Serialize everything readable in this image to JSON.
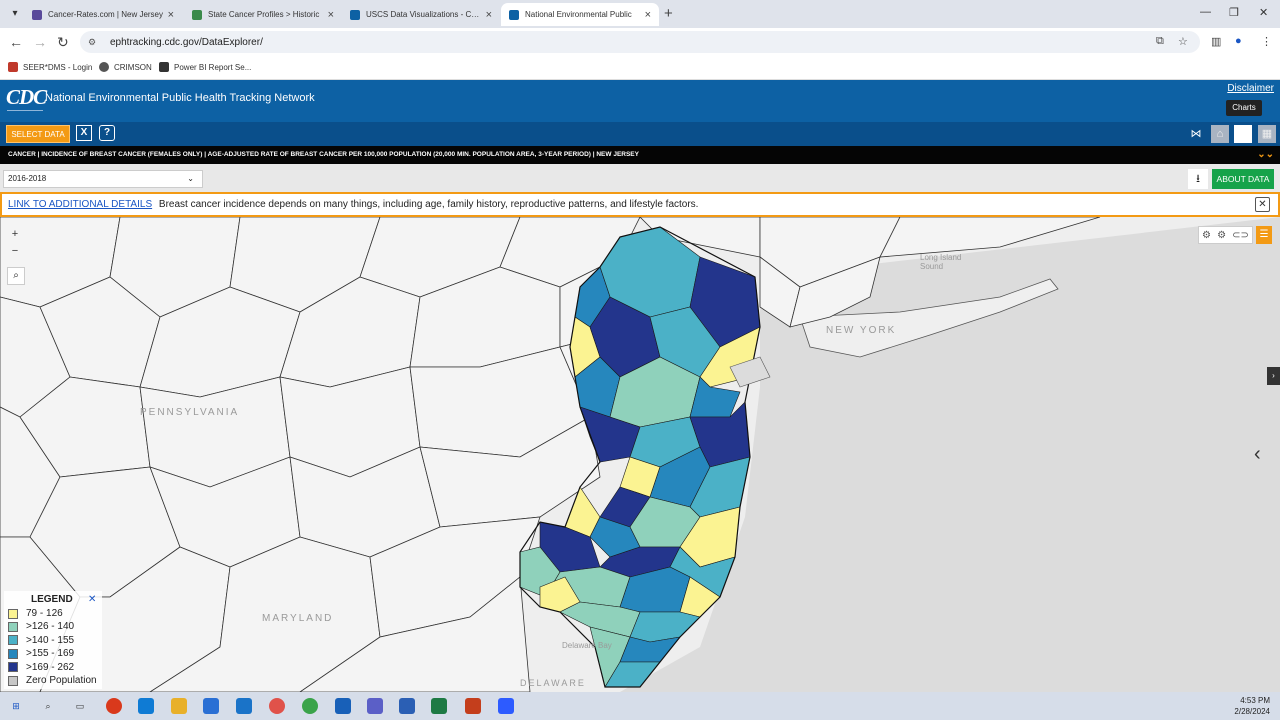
{
  "browser": {
    "tabs": [
      {
        "title": "Cancer-Rates.com | New Jersey",
        "active": false,
        "favicon_color": "#5a4a9a"
      },
      {
        "title": "State Cancer Profiles > Historic",
        "active": false,
        "favicon_color": "#3a8a4a"
      },
      {
        "title": "USCS Data Visualizations - CDC",
        "active": false,
        "favicon_color": "#0d61a4"
      },
      {
        "title": "National Environmental Public",
        "active": true,
        "favicon_color": "#0d61a4"
      }
    ],
    "url": "ephtracking.cdc.gov/DataExplorer/",
    "bookmarks": [
      {
        "label": "SEER*DMS - Login",
        "color": "#c0392b"
      },
      {
        "label": "CRIMSON",
        "color": "#555555"
      },
      {
        "label": "Power BI Report Se...",
        "color": "#333333"
      }
    ]
  },
  "site": {
    "logo": "CDC",
    "title": "National Environmental Public Health Tracking Network",
    "disclaimer": "Disclaimer",
    "select_data": "SELECT DATA",
    "clear_label": "X",
    "help_label": "?",
    "tooltip": "Charts",
    "breadcrumb": "CANCER | INCIDENCE OF BREAST CANCER (FEMALES ONLY) | AGE-ADJUSTED RATE OF BREAST CANCER PER 100,000 POPULATION (20,000 MIN. POPULATION AREA, 3-YEAR PERIOD) | NEW JERSEY",
    "year": "2016-2018",
    "about_data": "ABOUT DATA",
    "info_link": "LINK TO ADDITIONAL DETAILS",
    "info_text": "Breast cancer incidence depends on many things, including age, family history, reproductive patterns, and lifestyle factors."
  },
  "map": {
    "labels": {
      "pennsylvania": "PENNSYLVANIA",
      "new_york": "NEW YORK",
      "maryland": "MARYLAND",
      "delaware": "DELAWARE",
      "long_island_sound": "Long Island Sound",
      "delaware_bay": "Delaware Bay"
    },
    "legend": {
      "title": "LEGEND",
      "items": [
        {
          "label": "79 - 126",
          "color": "#fbf392"
        },
        {
          "label": ">126 - 140",
          "color": "#8fd1bb"
        },
        {
          "label": ">140 - 155",
          "color": "#4bb1c7"
        },
        {
          "label": ">155 - 169",
          "color": "#2687bd"
        },
        {
          "label": ">169 - 262",
          "color": "#23358c"
        },
        {
          "label": "Zero Population",
          "color": "#c7c7c7"
        }
      ]
    }
  },
  "taskbar": {
    "time": "4:53 PM",
    "date": "2/28/2024"
  }
}
